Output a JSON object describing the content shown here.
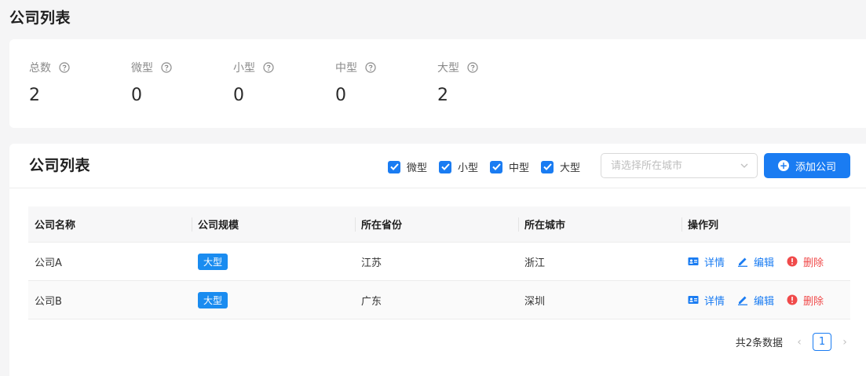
{
  "page": {
    "title": "公司列表"
  },
  "stats": [
    {
      "label": "总数",
      "value": "2"
    },
    {
      "label": "微型",
      "value": "0"
    },
    {
      "label": "小型",
      "value": "0"
    },
    {
      "label": "中型",
      "value": "0"
    },
    {
      "label": "大型",
      "value": "2"
    }
  ],
  "list": {
    "title": "公司列表",
    "filters": [
      {
        "label": "微型",
        "checked": true
      },
      {
        "label": "小型",
        "checked": true
      },
      {
        "label": "中型",
        "checked": true
      },
      {
        "label": "大型",
        "checked": true
      }
    ],
    "city_select": {
      "placeholder": "请选择所在城市",
      "value": ""
    },
    "add_button": "添加公司",
    "columns": [
      "公司名称",
      "公司规模",
      "所在省份",
      "所在城市",
      "操作列"
    ],
    "rows": [
      {
        "name": "公司A",
        "scale": "大型",
        "province": "江苏",
        "city": "浙江"
      },
      {
        "name": "公司B",
        "scale": "大型",
        "province": "广东",
        "city": "深圳"
      }
    ],
    "actions": {
      "detail": "详情",
      "edit": "编辑",
      "delete": "删除"
    },
    "pagination": {
      "total_text": "共2条数据",
      "current_page": "1"
    }
  },
  "colors": {
    "accent": "#1a7cf2",
    "danger": "#f04a4a",
    "tag": "#1a8cf0"
  }
}
